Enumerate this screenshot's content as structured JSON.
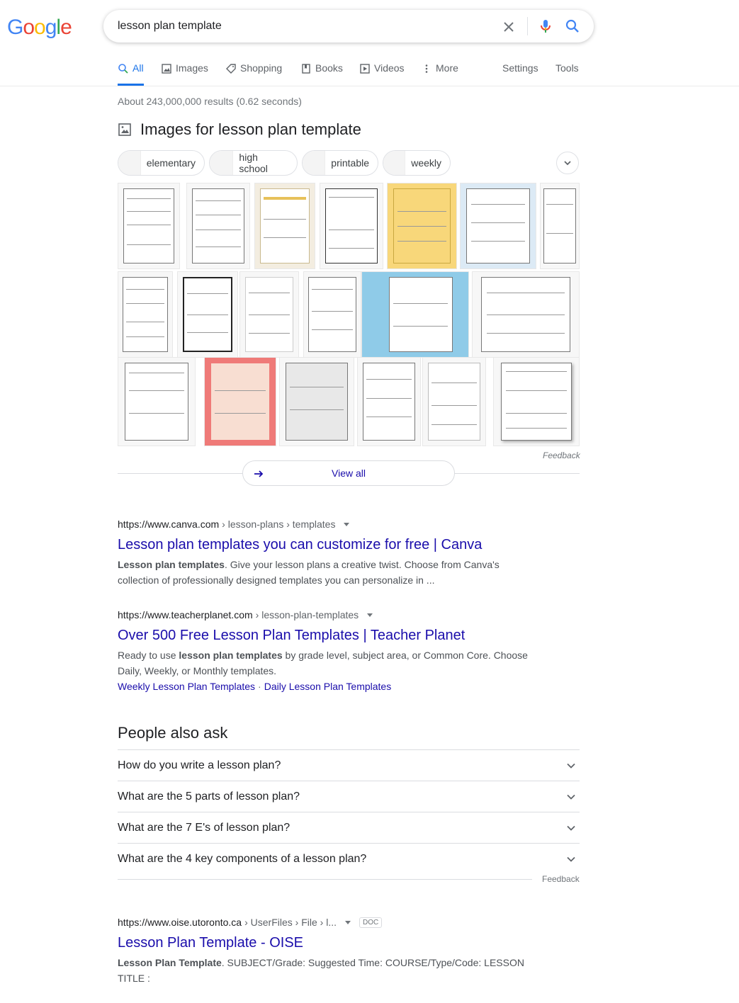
{
  "logo": [
    "G",
    "o",
    "o",
    "g",
    "l",
    "e"
  ],
  "logo_colors": [
    "#4285F4",
    "#EA4335",
    "#FBBC05",
    "#4285F4",
    "#34A853",
    "#EA4335"
  ],
  "search": {
    "query": "lesson plan template"
  },
  "tabs": [
    {
      "label": "All",
      "icon": "search-icon"
    },
    {
      "label": "Images",
      "icon": "image-icon"
    },
    {
      "label": "Shopping",
      "icon": "tag-icon"
    },
    {
      "label": "Books",
      "icon": "book-icon"
    },
    {
      "label": "Videos",
      "icon": "play-icon"
    },
    {
      "label": "More",
      "icon": "more-vert-icon"
    }
  ],
  "tools": {
    "settings": "Settings",
    "tools": "Tools"
  },
  "result_stats": "About 243,000,000 results (0.62 seconds)",
  "images": {
    "heading": "Images for lesson plan template",
    "chips": [
      "elementary",
      "high school",
      "printable",
      "weekly"
    ],
    "feedback": "Feedback",
    "view_all": "View all"
  },
  "results": [
    {
      "url": "https://www.canva.com",
      "path": "› lesson-plans › templates",
      "title": "Lesson plan templates you can customize for free | Canva",
      "snippet_bold": "Lesson plan templates",
      "snippet_rest": ". Give your lesson plans a creative twist. Choose from Canva's collection of professionally designed templates you can personalize in ..."
    },
    {
      "url": "https://www.teacherplanet.com",
      "path": "› lesson-plan-templates",
      "title": "Over 500 Free Lesson Plan Templates | Teacher Planet",
      "snippet_pre": "Ready to use ",
      "snippet_bold": "lesson plan templates",
      "snippet_rest": " by grade level, subject area, or Common Core. Choose Daily, Weekly, or Monthly templates.",
      "sitelinks": [
        "Weekly Lesson Plan Templates",
        "Daily Lesson Plan Templates"
      ]
    },
    {
      "url": "https://www.oise.utoronto.ca",
      "path": "› UserFiles › File › l...",
      "badge": "DOC",
      "title": "Lesson Plan Template - OISE",
      "snippet_bold": "Lesson Plan Template",
      "snippet_rest": ". SUBJECT/Grade: Suggested Time: COURSE/Type/Code: LESSON TITLE :"
    }
  ],
  "paa": {
    "title": "People also ask",
    "questions": [
      "How do you write a lesson plan?",
      "What are the 5 parts of lesson plan?",
      "What are the 7 E's of lesson plan?",
      "What are the 4 key components of a lesson plan?"
    ],
    "feedback": "Feedback"
  }
}
